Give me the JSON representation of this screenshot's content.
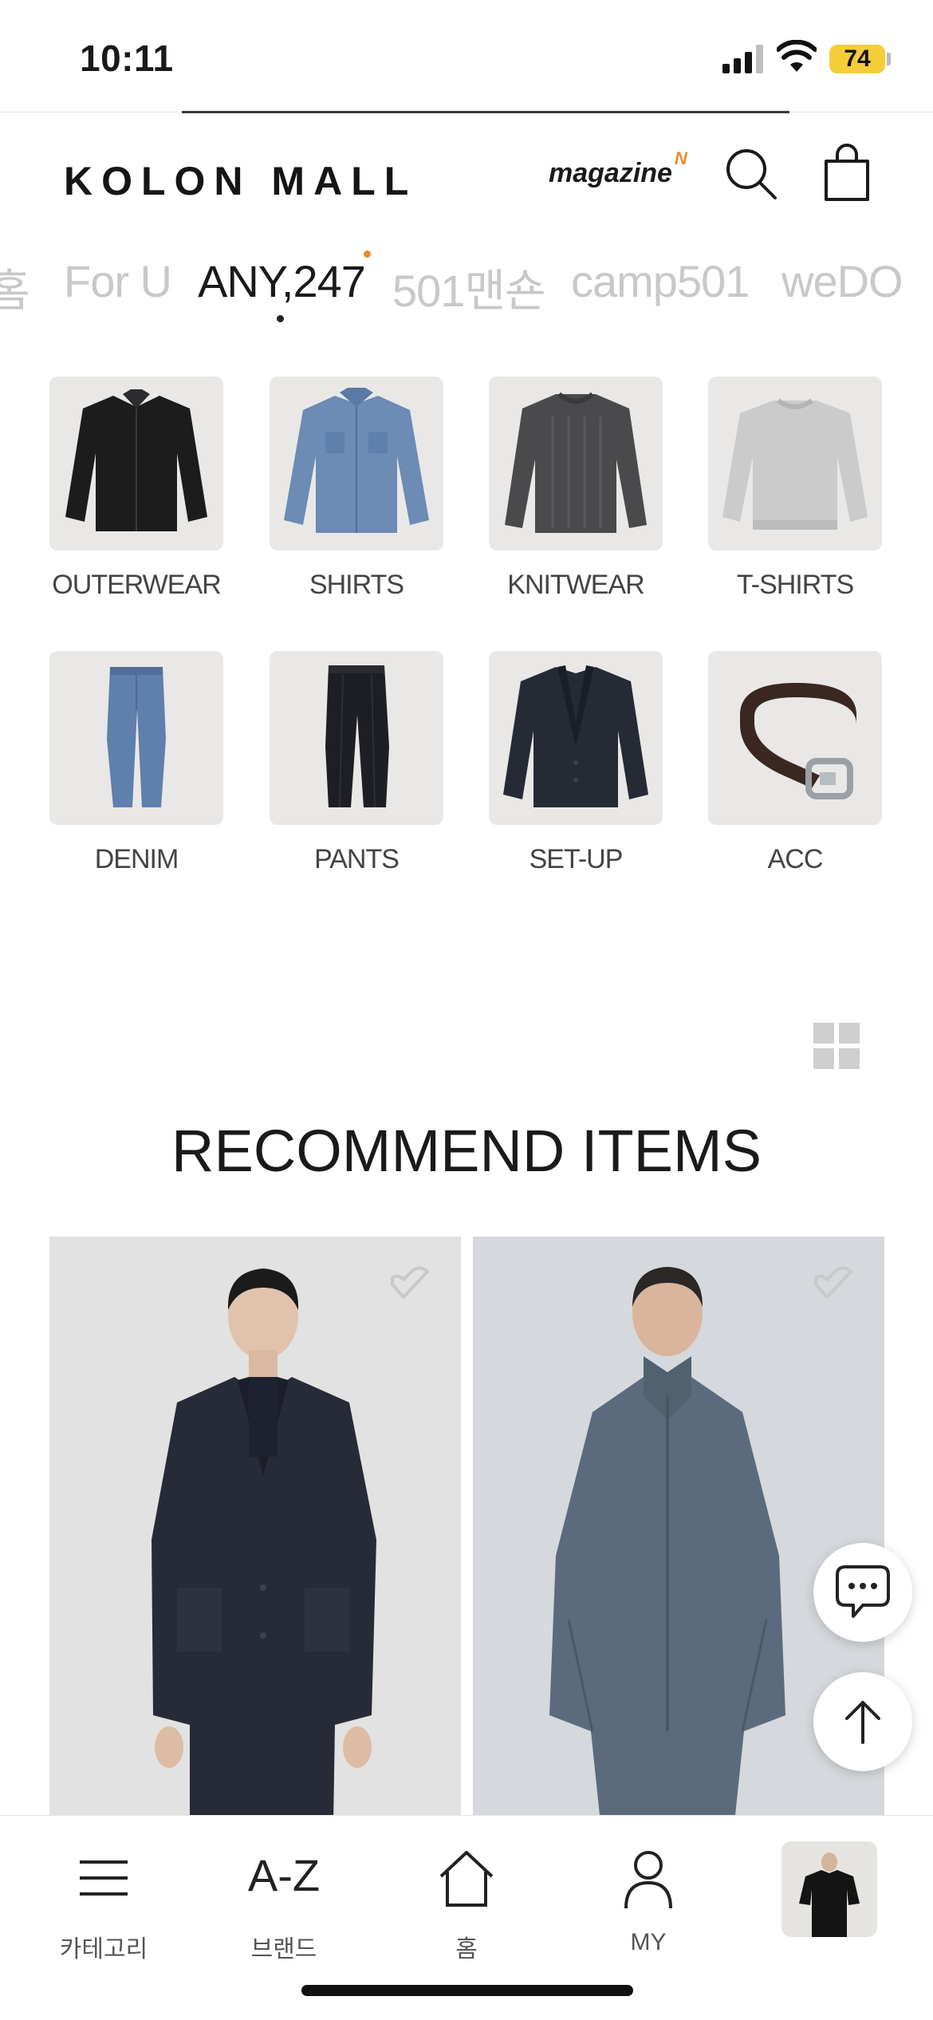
{
  "status_bar": {
    "time": "10:11",
    "battery": "74"
  },
  "header": {
    "logo": "KOLON MALL",
    "magazine": "magazine",
    "magazine_badge": "N"
  },
  "tabs": [
    {
      "label": "홈",
      "active": false
    },
    {
      "label": "For U",
      "active": false
    },
    {
      "label": "ANY,247",
      "active": true
    },
    {
      "label": "501맨숀",
      "active": false
    },
    {
      "label": "camp501",
      "active": false
    },
    {
      "label": "weDO",
      "active": false
    }
  ],
  "categories": [
    {
      "label": "OUTERWEAR",
      "icon": "jacket"
    },
    {
      "label": "SHIRTS",
      "icon": "shirt"
    },
    {
      "label": "KNITWEAR",
      "icon": "sweater"
    },
    {
      "label": "T-SHIRTS",
      "icon": "sweatshirt"
    },
    {
      "label": "DENIM",
      "icon": "jeans"
    },
    {
      "label": "PANTS",
      "icon": "trousers"
    },
    {
      "label": "SET-UP",
      "icon": "blazer"
    },
    {
      "label": "ACC",
      "icon": "belt"
    }
  ],
  "section": {
    "title": "RECOMMEND ITEMS"
  },
  "bottom_nav": [
    {
      "label": "카테고리",
      "icon": "menu-icon"
    },
    {
      "label": "브랜드",
      "icon_text": "A-Z"
    },
    {
      "label": "홈",
      "icon": "home-icon"
    },
    {
      "label": "MY",
      "icon": "user-icon"
    }
  ],
  "colors": {
    "accent": "#e88b2c",
    "battery": "#f4cd3a",
    "tile_background": "#e9e8e6",
    "inactive_tab": "#c8c8c8"
  }
}
